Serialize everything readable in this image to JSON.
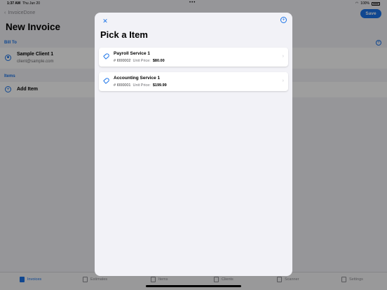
{
  "status_bar": {
    "time": "1:37 AM",
    "date": "Thu Jun 20",
    "battery": "100%"
  },
  "header": {
    "back_label": "InvoiceDone",
    "save_label": "Save",
    "title": "New Invoice"
  },
  "bill_to": {
    "section_label": "Bill To",
    "client_name": "Sample Client 1",
    "client_email": "client@sample.com"
  },
  "items_section": {
    "section_label": "Items",
    "add_label": "Add Item"
  },
  "tab_bar": [
    {
      "label": "Invoices",
      "active": true
    },
    {
      "label": "Estimates"
    },
    {
      "label": "Items"
    },
    {
      "label": "Clients"
    },
    {
      "label": "Scanner"
    },
    {
      "label": "Settings"
    }
  ],
  "modal": {
    "title": "Pick a Item",
    "items": [
      {
        "name": "Payroll Service 1",
        "number": "# I000002",
        "price_label": "Unit Price:",
        "price": "$80.00"
      },
      {
        "name": "Accounting Service 1",
        "number": "# I000001",
        "price_label": "Unit Price:",
        "price": "$199.99"
      }
    ]
  },
  "colors": {
    "accent": "#1a73e8",
    "background": "#f2f2f7"
  }
}
